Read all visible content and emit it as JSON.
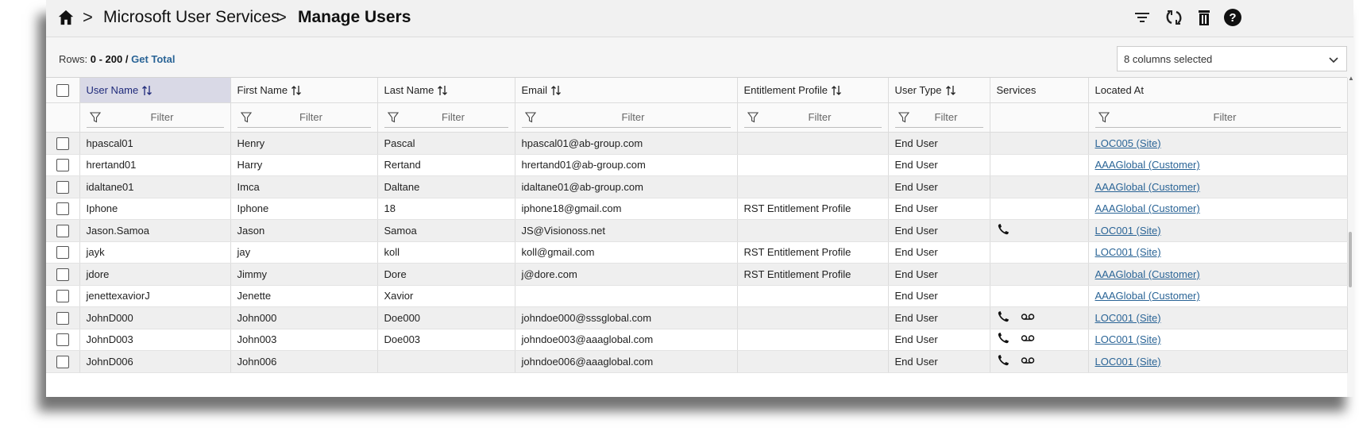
{
  "breadcrumb": {
    "home_icon": "home-icon",
    "parent": "Microsoft User Services",
    "current": "Manage Users",
    "separator": ">"
  },
  "toolbar": {
    "filter_icon": "filter-lines-icon",
    "refresh_icon": "refresh-icon",
    "delete_icon": "trash-icon",
    "help_icon": "help-icon"
  },
  "rows_info": {
    "label": "Rows:",
    "range": "0 - 200",
    "sep": "/",
    "get_total": "Get Total"
  },
  "column_selector": {
    "value": "8 columns selected"
  },
  "columns": [
    {
      "key": "username",
      "label": "User Name",
      "sortable": true,
      "filter": "Filter",
      "active": true
    },
    {
      "key": "first",
      "label": "First Name",
      "sortable": true,
      "filter": "Filter"
    },
    {
      "key": "last",
      "label": "Last Name",
      "sortable": true,
      "filter": "Filter"
    },
    {
      "key": "email",
      "label": "Email",
      "sortable": true,
      "filter": "Filter"
    },
    {
      "key": "profile",
      "label": "Entitlement Profile",
      "sortable": true,
      "filter": "Filter"
    },
    {
      "key": "type",
      "label": "User Type",
      "sortable": true,
      "filter": "Filter"
    },
    {
      "key": "services",
      "label": "Services",
      "sortable": false,
      "filter": ""
    },
    {
      "key": "location",
      "label": "Located At",
      "sortable": false,
      "filter": "Filter"
    }
  ],
  "rows": [
    {
      "username": "hpascal01",
      "first": "Henry",
      "last": "Pascal",
      "email": "hpascal01@ab-group.com",
      "profile": "",
      "type": "End User",
      "services": [],
      "location": "LOC005 (Site)"
    },
    {
      "username": "hrertand01",
      "first": "Harry",
      "last": "Rertand",
      "email": "hrertand01@ab-group.com",
      "profile": "",
      "type": "End User",
      "services": [],
      "location": "AAAGlobal (Customer)"
    },
    {
      "username": "idaltane01",
      "first": "Imca",
      "last": "Daltane",
      "email": "idaltane01@ab-group.com",
      "profile": "",
      "type": "End User",
      "services": [],
      "location": "AAAGlobal (Customer)"
    },
    {
      "username": "Iphone",
      "first": "Iphone",
      "last": "18",
      "email": "iphone18@gmail.com",
      "profile": "RST Entitlement Profile",
      "type": "End User",
      "services": [],
      "location": "AAAGlobal (Customer)"
    },
    {
      "username": "Jason.Samoa",
      "first": "Jason",
      "last": "Samoa",
      "email": "JS@Visionoss.net",
      "profile": "",
      "type": "End User",
      "services": [
        "phone-icon"
      ],
      "location": "LOC001 (Site)"
    },
    {
      "username": "jayk",
      "first": "jay",
      "last": "koll",
      "email": "koll@gmail.com",
      "profile": "RST Entitlement Profile",
      "type": "End User",
      "services": [],
      "location": "LOC001 (Site)"
    },
    {
      "username": "jdore",
      "first": "Jimmy",
      "last": "Dore",
      "email": "j@dore.com",
      "profile": "RST Entitlement Profile",
      "type": "End User",
      "services": [],
      "location": "AAAGlobal (Customer)"
    },
    {
      "username": "jenettexaviorJ",
      "first": "Jenette",
      "last": "Xavior",
      "email": "",
      "profile": "",
      "type": "End User",
      "services": [],
      "location": "AAAGlobal (Customer)"
    },
    {
      "username": "JohnD000",
      "first": "John000",
      "last": "Doe000",
      "email": "johndoe000@sssglobal.com",
      "profile": "",
      "type": "End User",
      "services": [
        "phone-icon",
        "voicemail-icon"
      ],
      "location": "LOC001 (Site)"
    },
    {
      "username": "JohnD003",
      "first": "John003",
      "last": "Doe003",
      "email": "johndoe003@aaaglobal.com",
      "profile": "",
      "type": "End User",
      "services": [
        "phone-icon",
        "voicemail-icon"
      ],
      "location": "LOC001 (Site)"
    },
    {
      "username": "JohnD006",
      "first": "John006",
      "last": "",
      "email": "johndoe006@aaaglobal.com",
      "profile": "",
      "type": "End User",
      "services": [
        "phone-icon",
        "voicemail-icon"
      ],
      "location": "LOC001 (Site)"
    }
  ]
}
